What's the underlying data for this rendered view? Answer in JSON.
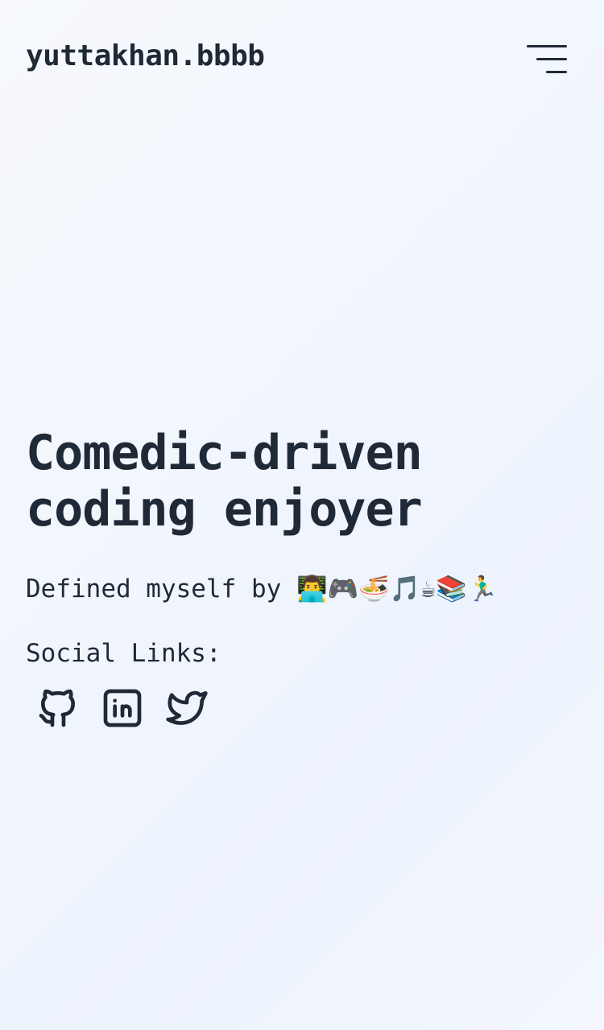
{
  "header": {
    "site_title": "yuttakhan.bbbb",
    "menu_icon": "hamburger-menu-icon"
  },
  "hero": {
    "headline_line1": "Comedic-driven",
    "headline_line2": "coding enjoyer",
    "tagline": "Defined myself by 👨‍💻🎮🍜🎵☕📚🏃‍♂️",
    "social_label": "Social Links:"
  },
  "social_links": [
    {
      "name": "GitHub",
      "icon": "github-icon"
    },
    {
      "name": "LinkedIn",
      "icon": "linkedin-icon"
    },
    {
      "name": "Twitter",
      "icon": "twitter-icon"
    }
  ],
  "colors": {
    "text": "#1f2a36",
    "background_start": "#f7f9fd",
    "background_end": "#edf3fd"
  }
}
